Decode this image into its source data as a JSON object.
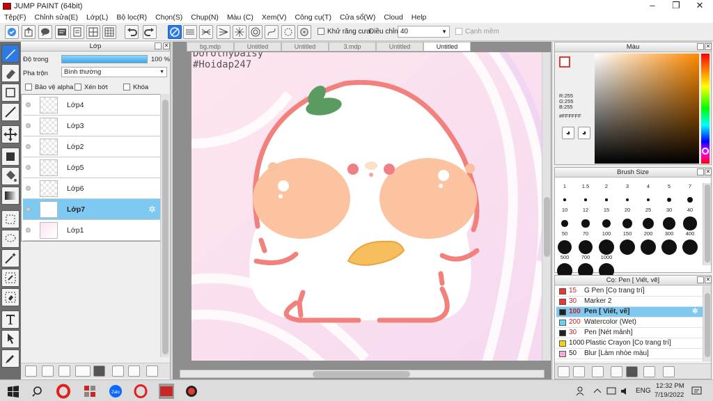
{
  "window": {
    "title": "JUMP PAINT (64bit)"
  },
  "menu": [
    "Tệp(F)",
    "Chỉnh sửa(E)",
    "Lớp(L)",
    "Bộ lọc(R)",
    "Chọn(S)",
    "Chụp(N)",
    "Màu (C)",
    "Xem(V)",
    "Công cụ(T)",
    "Cửa sổ(W)",
    "Cloud",
    "Help"
  ],
  "toolbar": {
    "antialias_label": "Khử răng cưa",
    "correction_label": "Điều chỉnh",
    "correction_value": "40",
    "snap_label": "Cạnh mềm"
  },
  "layer_panel": {
    "title": "Lớp",
    "opacity_label": "Độ trong",
    "opacity_value": "100 %",
    "opacity_fraction": 1.0,
    "blend_label": "Pha trộn",
    "blend_value": "Bình thường",
    "protect_alpha": "Bảo vệ alpha",
    "clip": "Xén bớt",
    "lock": "Khóa",
    "layers": [
      "Lớp4",
      "Lớp3",
      "Lớp2",
      "Lớp5",
      "Lớp6",
      "Lớp7",
      "Lớp1"
    ],
    "selected": "Lớp7"
  },
  "tabs": [
    "bg.mdp",
    "Untitled",
    "Untitled",
    "3.mdp",
    "Untitled",
    "Untitled"
  ],
  "canvas": {
    "watermark_1": "DorothyDaisy",
    "watermark_2": "#Hoidap247"
  },
  "color_panel": {
    "title": "Màu",
    "r": "R:255",
    "g": "G:255",
    "b": "B:255",
    "hex": "#FFFFFF",
    "accent": "#e53935"
  },
  "brush_size": {
    "title": "Brush Size",
    "sizes": [
      "1",
      "1.5",
      "2",
      "3",
      "4",
      "5",
      "7",
      "10",
      "12",
      "15",
      "20",
      "25",
      "30",
      "40",
      "50",
      "70",
      "100",
      "150",
      "200",
      "300",
      "400",
      "500",
      "700",
      "1000"
    ]
  },
  "brush_panel": {
    "title": "Cọ: Pen [ Viết, vẽ]",
    "items": [
      {
        "size": "15",
        "name": "G Pen [Cọ trang trí]",
        "color": "#e53935"
      },
      {
        "size": "30",
        "name": "Marker 2",
        "color": "#e53935"
      },
      {
        "size": "100",
        "name": "Pen [ Viết, vẽ]",
        "color": "#222222"
      },
      {
        "size": "200",
        "name": "Watercolor (Wet)",
        "color": "#6ecff6"
      },
      {
        "size": "30",
        "name": "Pen [Nét mảnh]",
        "color": "#222222"
      },
      {
        "size": "1000",
        "name": "Plastic Crayon [Cọ trang trí]",
        "color": "#f2d21b"
      },
      {
        "size": "50",
        "name": "Blur [Làm nhòe màu]",
        "color": "#f7a8e0"
      }
    ]
  },
  "taskbar": {
    "lang": "ENG",
    "time": "12:32 PM",
    "date": "7/19/2022"
  }
}
